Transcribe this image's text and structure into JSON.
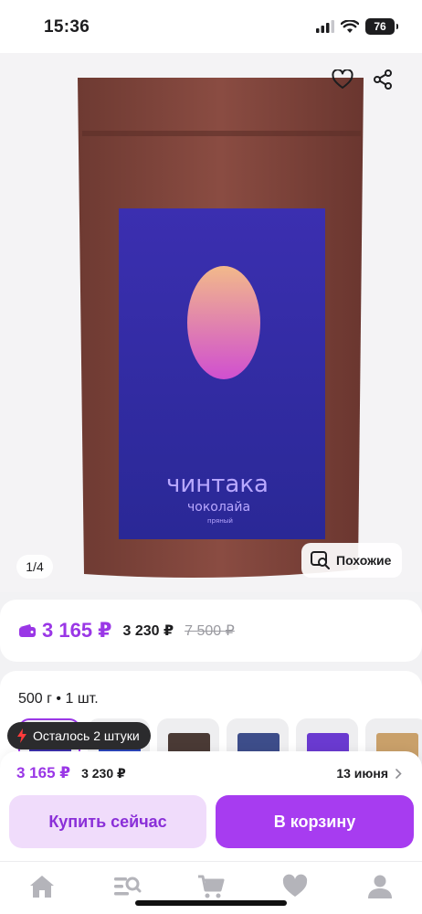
{
  "status_bar": {
    "time": "15:36",
    "battery": "76",
    "icons": [
      "signal-icon",
      "wifi-icon",
      "battery-icon"
    ]
  },
  "gallery": {
    "icons": [
      "heart-icon",
      "share-icon"
    ],
    "package": {
      "brand": "чинтака",
      "product": "чоколайа",
      "variant": "пряный"
    },
    "pager": "1/4",
    "similar_label": "Похожие",
    "similar_icon": "image-search-icon"
  },
  "price": {
    "wallet_icon": "wallet-icon",
    "main": "3 165 ₽",
    "regular": "3 230 ₽",
    "old": "7 500 ₽",
    "accent_color": "#9a37e6"
  },
  "variant": {
    "label": "500 г • 1 шт.",
    "thumbs": [
      {
        "selected": true
      },
      {
        "selected": false
      },
      {
        "selected": false
      },
      {
        "selected": false
      },
      {
        "selected": false
      },
      {
        "selected": false
      }
    ]
  },
  "stock_badge": {
    "icon": "lightning-icon",
    "text": "Осталось 2 штуки"
  },
  "buy_panel": {
    "price_main": "3 165 ₽",
    "price_regular": "3 230 ₽",
    "delivery_date": "13 июня",
    "buy_now": "Купить сейчас",
    "add_to_cart": "В корзину"
  },
  "tab_bar": {
    "tabs": [
      "home-icon",
      "catalog-search-icon",
      "cart-icon",
      "favorites-icon",
      "profile-icon"
    ]
  }
}
